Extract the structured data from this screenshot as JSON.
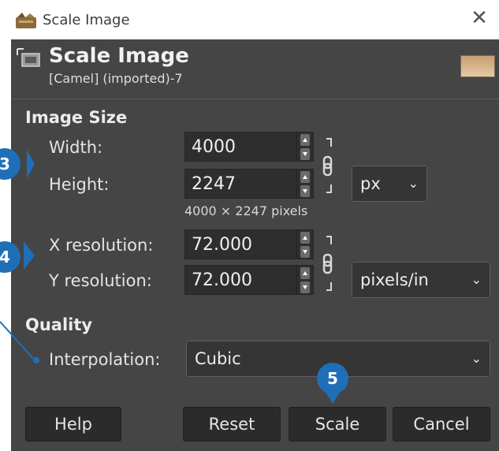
{
  "window": {
    "title": "Scale Image",
    "close_glyph": "✕"
  },
  "header": {
    "title": "Scale Image",
    "subtitle": "[Camel] (imported)-7",
    "icon": "scale-image-icon"
  },
  "image_size": {
    "section_title": "Image Size",
    "width_label": "Width:",
    "width_value": "4000",
    "height_label": "Height:",
    "height_value": "2247",
    "unit": "px",
    "pixels_text": "4000 × 2247 pixels"
  },
  "resolution": {
    "x_label": "X resolution:",
    "x_value": "72.000",
    "y_label": "Y resolution:",
    "y_value": "72.000",
    "unit": "pixels/in"
  },
  "quality": {
    "section_title": "Quality",
    "interpolation_label": "Interpolation:",
    "interpolation_value": "Cubic"
  },
  "buttons": {
    "help": "Help",
    "reset": "Reset",
    "scale": "Scale",
    "cancel": "Cancel"
  },
  "callouts": {
    "c3": "3",
    "c4": "4",
    "c5": "5"
  },
  "colors": {
    "dialog_bg": "#454545",
    "callout": "#1f6fb8"
  }
}
